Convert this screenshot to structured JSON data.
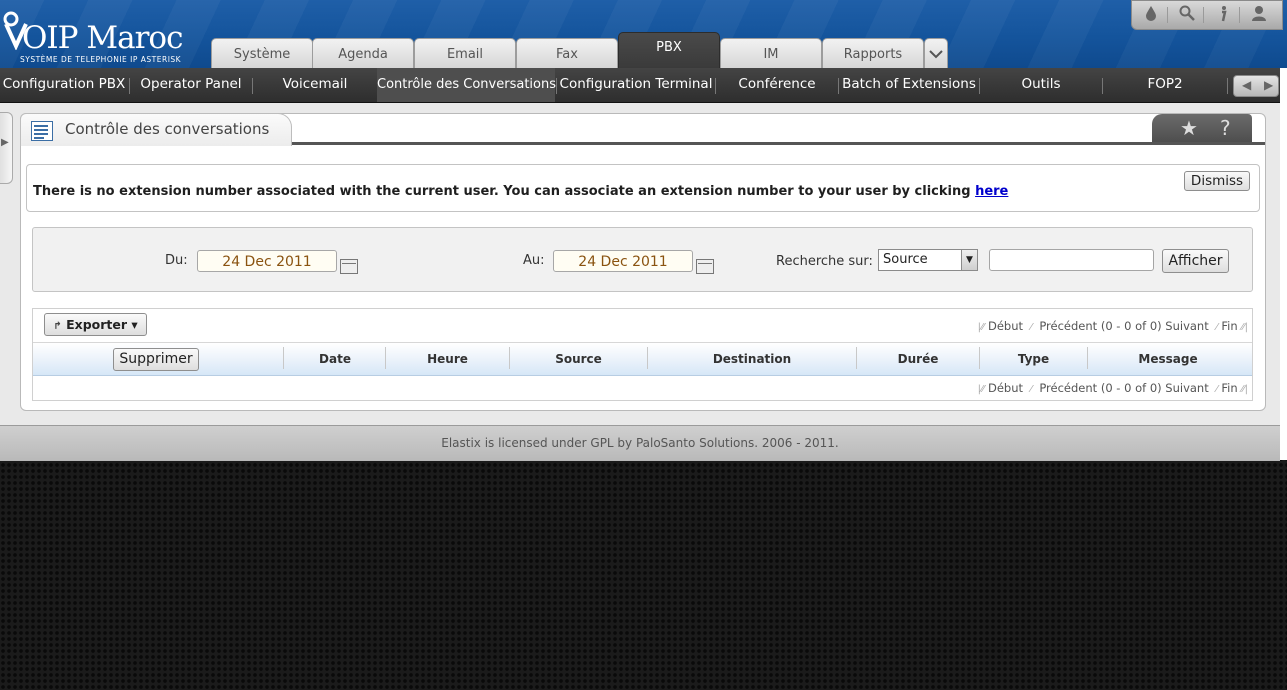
{
  "logo": {
    "brand": "OIP Maroc",
    "tagline": "SYSTÈME DE TELEPHONIE IP ASTERISK"
  },
  "toolbar_icons": [
    "droplet-icon",
    "search-icon",
    "info-icon",
    "user-icon"
  ],
  "main_tabs": [
    "Système",
    "Agenda",
    "Email",
    "Fax",
    "PBX",
    "IM",
    "Rapports"
  ],
  "main_tabs_active": "PBX",
  "sub_nav": [
    "Configuration PBX",
    "Operator Panel",
    "Voicemail",
    "Contrôle des Conversations",
    "Configuration Terminal",
    "Conférence",
    "Batch of Extensions",
    "Outils",
    "FOP2"
  ],
  "sub_nav_active": "Contrôle des Conversations",
  "page": {
    "title": "Contrôle des conversations",
    "alert_text": "There is no extension number associated with the current user. You can associate an extension number to your user by clicking ",
    "alert_link": "here",
    "dismiss": "Dismiss"
  },
  "filter": {
    "from_label": "Du:",
    "from_value": "24 Dec 2011",
    "to_label": "Au:",
    "to_value": "24 Dec 2011",
    "search_label": "Recherche sur:",
    "search_field": "Source",
    "search_value": "",
    "submit": "Afficher"
  },
  "grid": {
    "export": "Exporter ▾",
    "pager": {
      "first": "Début",
      "prev": "Précédent",
      "range": "(0 - 0 of 0)",
      "next": "Suivant",
      "last": "Fin"
    },
    "delete_button": "Supprimer",
    "columns": [
      "Date",
      "Heure",
      "Source",
      "Destination",
      "Durée",
      "Type",
      "Message"
    ]
  },
  "footer": "Elastix is licensed under GPL by PaloSanto Solutions. 2006 - 2011."
}
